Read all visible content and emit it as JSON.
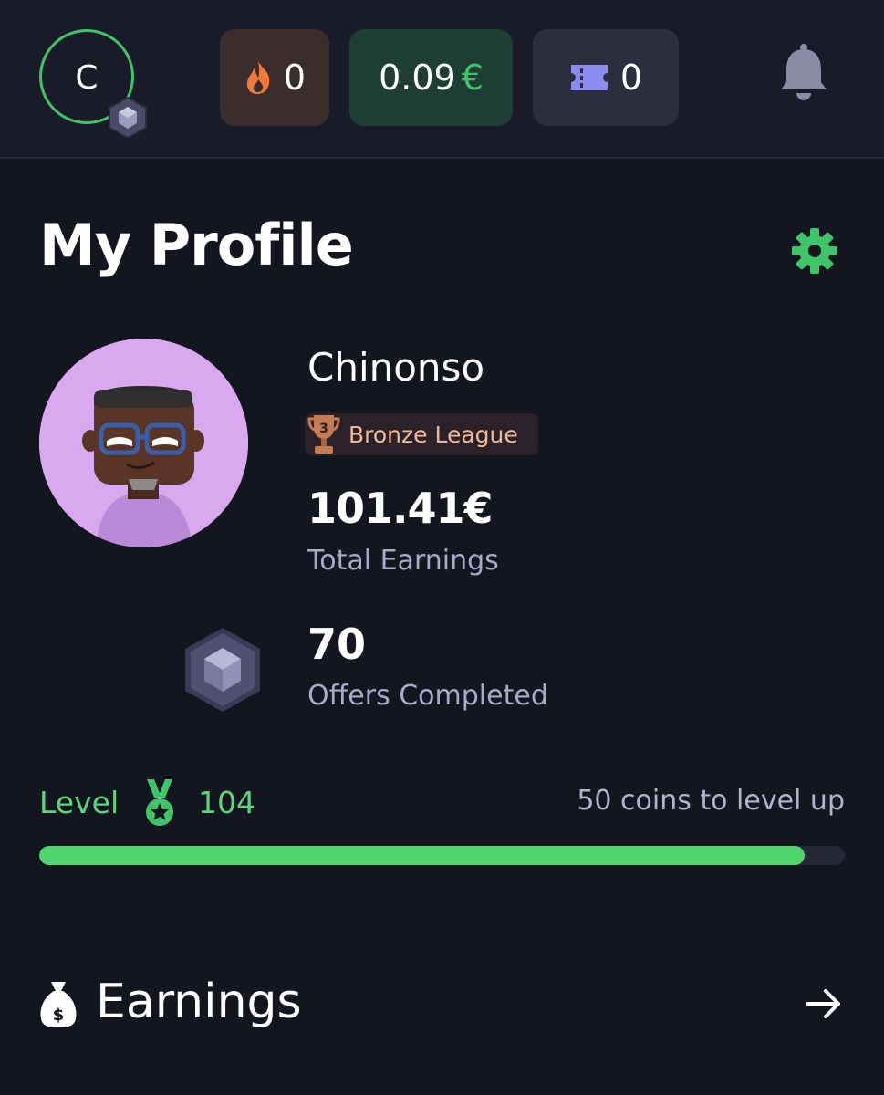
{
  "header": {
    "avatar_letter": "C",
    "streak_count": "0",
    "balance_amount": "0.09",
    "balance_currency": "€",
    "tickets_count": "0",
    "icons": [
      "flame-icon",
      "ticket-icon",
      "bell-icon",
      "gem-icon"
    ]
  },
  "page": {
    "title": "My Profile",
    "settings_icon": "gear-icon"
  },
  "profile": {
    "username": "Chinonso",
    "league": "Bronze League",
    "total_earnings": "101.41€",
    "total_earnings_label": "Total Earnings",
    "offers_completed": "70",
    "offers_completed_label": "Offers Completed"
  },
  "level": {
    "label": "Level",
    "number": "104",
    "hint": "50 coins to level up",
    "progress_fraction": 0.95
  },
  "section": {
    "title": "Earnings",
    "icon": "money-bag-icon",
    "action_icon": "arrow-right-icon"
  },
  "colors": {
    "accent": "#3fc46a",
    "background": "#13151f",
    "topbar": "#191b29",
    "bronze": "#c57c52"
  }
}
